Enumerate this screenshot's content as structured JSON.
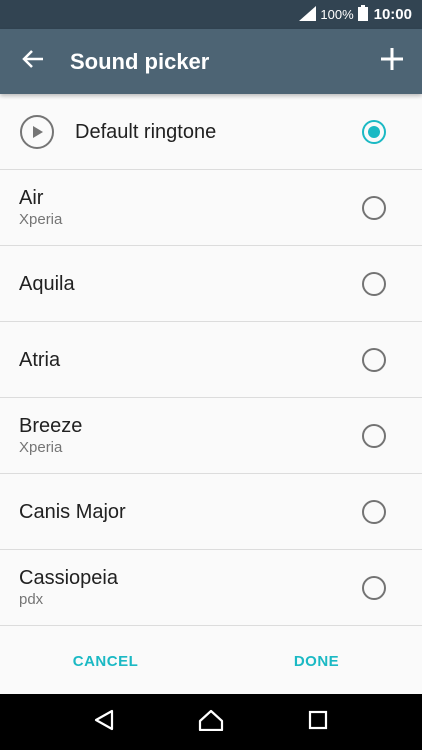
{
  "status_bar": {
    "battery_percent": "100%",
    "time": "10:00"
  },
  "app_bar": {
    "title": "Sound picker"
  },
  "list": {
    "default": {
      "label": "Default ringtone",
      "selected": true
    },
    "items": [
      {
        "label": "Air",
        "sublabel": "Xperia",
        "selected": false
      },
      {
        "label": "Aquila",
        "sublabel": "",
        "selected": false
      },
      {
        "label": "Atria",
        "sublabel": "",
        "selected": false
      },
      {
        "label": "Breeze",
        "sublabel": "Xperia",
        "selected": false
      },
      {
        "label": "Canis Major",
        "sublabel": "",
        "selected": false
      },
      {
        "label": "Cassiopeia",
        "sublabel": "pdx",
        "selected": false
      }
    ]
  },
  "actions": {
    "cancel_label": "CANCEL",
    "done_label": "DONE"
  },
  "colors": {
    "accent": "#1bb9c4",
    "app_bar": "#4d6474",
    "status_bar": "#324452"
  },
  "icons": {
    "back": "arrow-left-icon",
    "add": "plus-icon",
    "play": "play-icon",
    "signal": "signal-icon",
    "battery": "battery-icon",
    "nav_back": "triangle-back-icon",
    "nav_home": "home-icon",
    "nav_recents": "square-recents-icon"
  }
}
